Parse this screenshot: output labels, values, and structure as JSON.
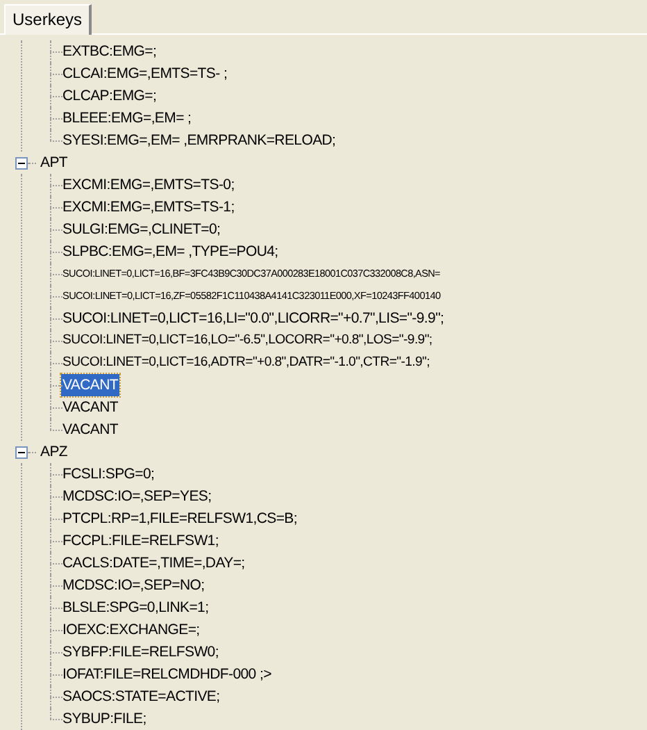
{
  "tabs": [
    {
      "label": "Userkeys",
      "selected": true
    }
  ],
  "tree": {
    "continued_items": [
      {
        "label": "EXTBC:EMG=;",
        "selected": false
      },
      {
        "label": "CLCAI:EMG=,EMTS=TS-  ;",
        "selected": false
      },
      {
        "label": "CLCAP:EMG=;",
        "selected": false
      },
      {
        "label": "BLEEE:EMG=,EM=  ;",
        "selected": false
      },
      {
        "label": "SYESI:EMG=,EM=   ,EMRPRANK=RELOAD;",
        "selected": false
      }
    ],
    "groups": [
      {
        "label": "APT",
        "expanded": true,
        "children": [
          {
            "label": "EXCMI:EMG=,EMTS=TS-0;",
            "selected": false
          },
          {
            "label": "EXCMI:EMG=,EMTS=TS-1;",
            "selected": false
          },
          {
            "label": "SULGI:EMG=,CLINET=0;",
            "selected": false
          },
          {
            "label": "SLPBC:EMG=,EM=   ,TYPE=POU4;",
            "selected": false
          },
          {
            "label": "SUCOI:LINET=0,LICT=16,BF=3FC43B9C30DC37A000283E18001C037C332008C8,ASN=",
            "selected": false
          },
          {
            "label": "SUCOI:LINET=0,LICT=16,ZF=05582F1C110438A4141C323011E000,XF=10243FF400140",
            "selected": false
          },
          {
            "label": "SUCOI:LINET=0,LICT=16,LI=\"0.0\",LICORR=\"+0.7\",LIS=\"-9.9\";",
            "selected": false
          },
          {
            "label": "SUCOI:LINET=0,LICT=16,LO=\"-6.5\",LOCORR=\"+0.8\",LOS=\"-9.9\";",
            "selected": false
          },
          {
            "label": "SUCOI:LINET=0,LICT=16,ADTR=\"+0.8\",DATR=\"-1.0\",CTR=\"-1.9\";",
            "selected": false
          },
          {
            "label": "VACANT",
            "selected": true
          },
          {
            "label": "VACANT",
            "selected": false
          },
          {
            "label": "VACANT",
            "selected": false
          }
        ]
      },
      {
        "label": "APZ",
        "expanded": true,
        "children": [
          {
            "label": "FCSLI:SPG=0;",
            "selected": false
          },
          {
            "label": "MCDSC:IO=,SEP=YES;",
            "selected": false
          },
          {
            "label": "PTCPL:RP=1,FILE=RELFSW1,CS=B;",
            "selected": false
          },
          {
            "label": "FCCPL:FILE=RELFSW1;",
            "selected": false
          },
          {
            "label": "CACLS:DATE=,TIME=,DAY=;",
            "selected": false
          },
          {
            "label": "MCDSC:IO=,SEP=NO;",
            "selected": false
          },
          {
            "label": "BLSLE:SPG=0,LINK=1;",
            "selected": false
          },
          {
            "label": "IOEXC:EXCHANGE=;",
            "selected": false
          },
          {
            "label": "SYBFP:FILE=RELFSW0;",
            "selected": false
          },
          {
            "label": "IOFAT:FILE=RELCMDHDF-000    ;>",
            "selected": false
          },
          {
            "label": "SAOCS:STATE=ACTIVE;",
            "selected": false
          },
          {
            "label": "SYBUP:FILE;",
            "selected": false
          }
        ]
      }
    ]
  }
}
